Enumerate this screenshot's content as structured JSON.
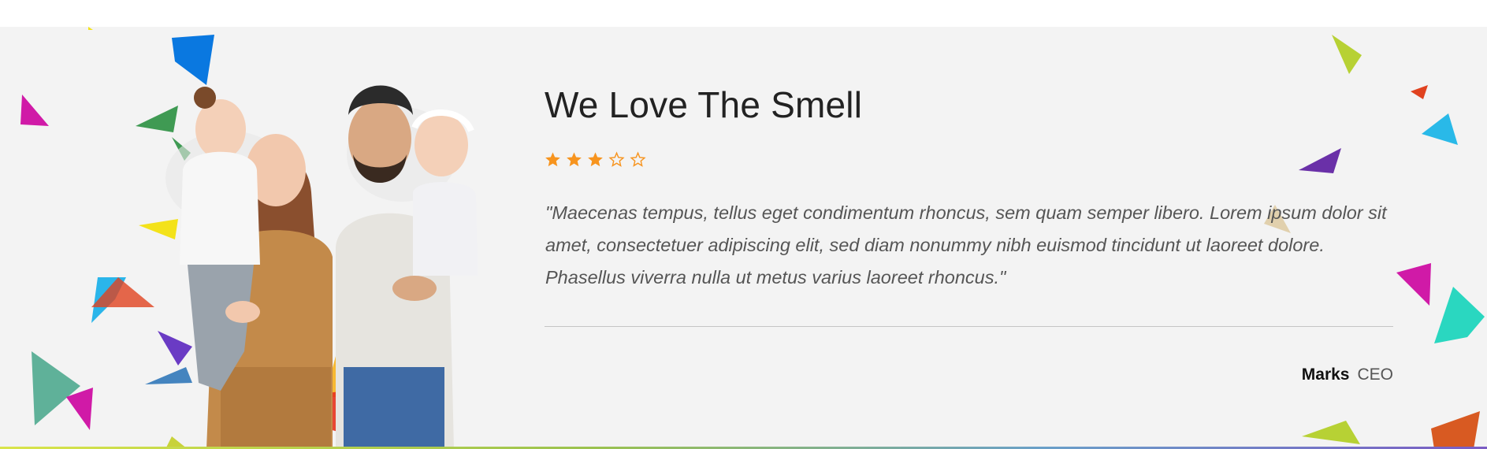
{
  "testimonial": {
    "title": "We Love The Smell",
    "rating": 3,
    "rating_max": 5,
    "quote": "\"Maecenas tempus, tellus eget condimentum rhoncus, sem quam semper libero. Lorem ipsum dolor sit amet, consectetuer adipiscing elit, sed diam nonummy nibh euismod tincidunt ut laoreet dolore. Phasellus viverra nulla ut metus varius laoreet rhoncus.\"",
    "author_name": "Marks",
    "author_role": "CEO"
  },
  "colors": {
    "background": "#f3f3f3",
    "star_filled": "#f7941e",
    "star_empty": "#f7941e",
    "title_text": "#222222",
    "quote_text": "#555555",
    "divider": "#c4c4c4"
  }
}
